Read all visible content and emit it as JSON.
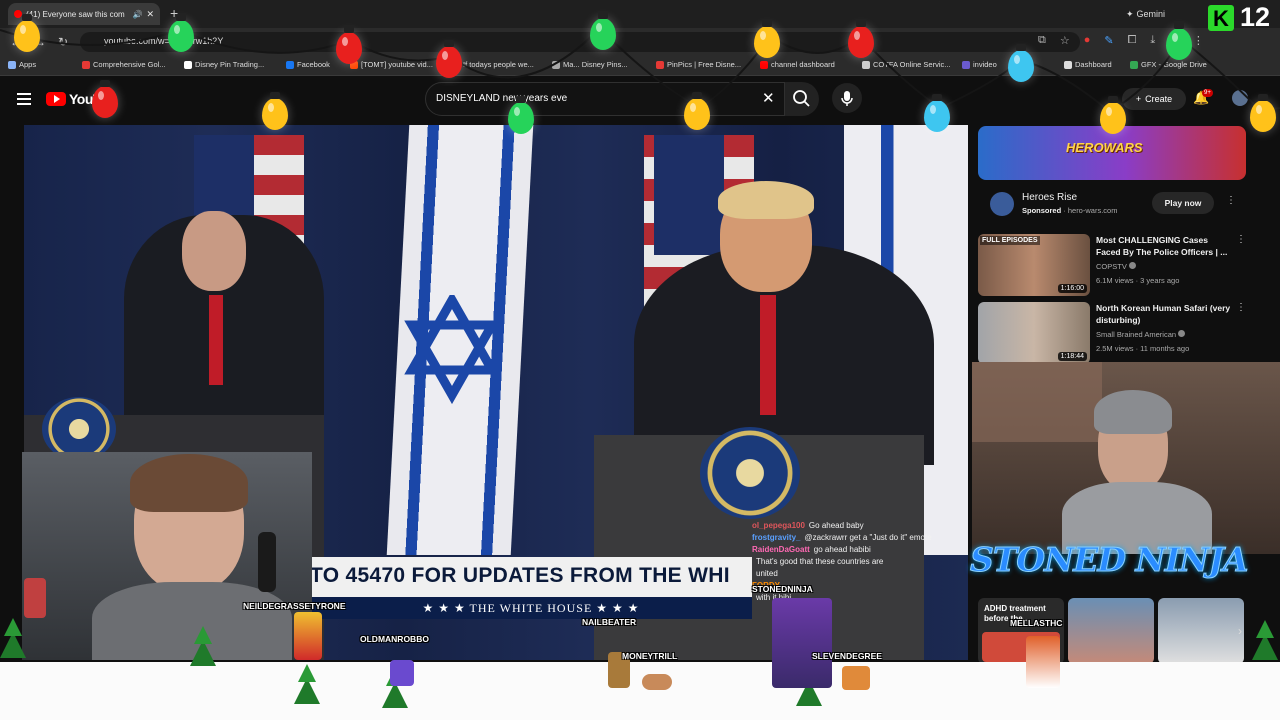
{
  "browser": {
    "tab_title": "(41) Everyone saw this com",
    "new_tab_glyph": "+",
    "gemini_label": "Gemini",
    "url": "youtube.com/w",
    "url_tail": "=ctLdSrw1h2Y",
    "bookmarks": [
      {
        "label": "Apps",
        "color": "#8ab4f8"
      },
      {
        "label": "Comprehensive Gol...",
        "color": "#e53935"
      },
      {
        "label": "Disney Pin Trading...",
        "color": "#ffffff"
      },
      {
        "label": "Facebook",
        "color": "#1877f2"
      },
      {
        "label": "[TOMT] youtube vid...",
        "color": "#ff4500"
      },
      {
        "label": "If todays people we...",
        "color": "#ff4500"
      },
      {
        "label": "Ma... Disney Pins...",
        "color": "#aaaaaa"
      },
      {
        "label": "PinPics | Free Disne...",
        "color": "#e53935"
      },
      {
        "label": "channel dashboard",
        "color": "#ff0000"
      },
      {
        "label": "COTFA Online Servic...",
        "color": "#cccccc"
      },
      {
        "label": "invideo",
        "color": "#6a5acd"
      },
      {
        "label": "Dashboard",
        "color": "#dddddd"
      },
      {
        "label": "GFX - Google Drive",
        "color": "#34a853"
      }
    ]
  },
  "youtube": {
    "logo_text": "YouT",
    "search_value": "DISNEYLAND new years eve",
    "create_label": "Create",
    "notif_count": "9+"
  },
  "video": {
    "ticker_text": "TO 45470 FOR UPDATES FROM THE WHI",
    "wh_bar_text": "★ ★ ★   THE WHITE HOUSE   ★ ★ ★"
  },
  "chat": [
    {
      "user": "ol_pepega100",
      "msg": "Go ahead baby",
      "color": "#e0565b"
    },
    {
      "user": "frostgravity_",
      "msg": "@zackrawrr get a \"Just do it\" emote",
      "color": "#5aa0ff"
    },
    {
      "user": "RaidenDaGoatt",
      "msg": "go ahead habibi",
      "color": "#ff69b4"
    },
    {
      "user": "",
      "msg": "That's good that these countries are",
      "color": "#ffffff"
    },
    {
      "user": "",
      "msg": "united",
      "color": "#ffffff"
    },
    {
      "user": "FORDY",
      "msg": "",
      "color": "#ff8c00"
    },
    {
      "user": "",
      "msg": "with it hihi",
      "color": "#ffffff"
    }
  ],
  "sidebar": {
    "ad": {
      "banner_text": "HEROWARS",
      "title": "Heroes Rise",
      "sponsored": "Sponsored",
      "domain": "· hero-wars.com",
      "cta": "Play now"
    },
    "recs": [
      {
        "title": "Most CHALLENGING Cases Faced By The Police Officers | ...",
        "channel": "COPSTV",
        "meta": "6.1M views · 3 years ago",
        "duration": "1:16:00",
        "badge": "FULL EPISODES"
      },
      {
        "title": "North Korean Human Safari (very disturbing)",
        "channel": "Small Brained American",
        "meta": "2.5M views · 11 months ago",
        "duration": "1:18:44",
        "badge": ""
      }
    ],
    "stream_overlay": "STONED NINJA",
    "short_label": "ADHD treatment before the..."
  },
  "overlay_names": [
    "NEILDEGRASSETYRONE",
    "OLDMANROBBO",
    "NAILBEATER",
    "STONEDNINJA",
    "MONEYTRILL",
    "SLEVENDEGREE",
    "MELLASTHC"
  ],
  "kick_badge": {
    "letter": "K",
    "count": "12"
  }
}
